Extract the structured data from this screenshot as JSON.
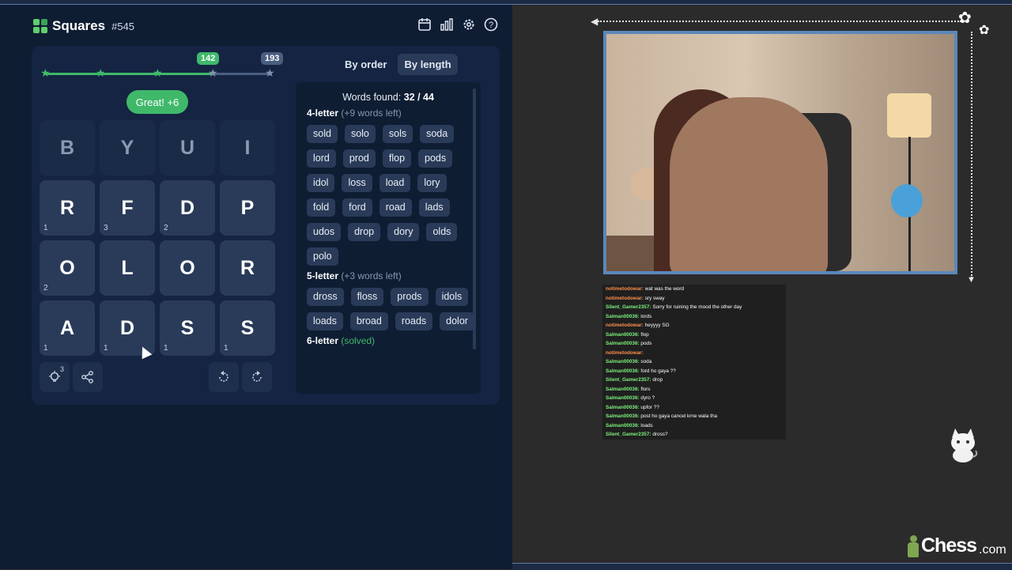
{
  "game": {
    "title": "Squares",
    "number": "#545",
    "icons": [
      "calendar-icon",
      "stats-icon",
      "gear-icon",
      "help-icon"
    ],
    "progress": {
      "current_score_fraction": 0.736,
      "markers": [
        {
          "label": "142"
        },
        {
          "label": "193"
        }
      ]
    },
    "feedback": "Great! +6",
    "tiles": [
      {
        "letter": "B",
        "count": "",
        "dim": true
      },
      {
        "letter": "Y",
        "count": "",
        "dim": true
      },
      {
        "letter": "U",
        "count": "",
        "dim": true
      },
      {
        "letter": "I",
        "count": "",
        "dim": true
      },
      {
        "letter": "R",
        "count": "1"
      },
      {
        "letter": "F",
        "count": "3"
      },
      {
        "letter": "D",
        "count": "2"
      },
      {
        "letter": "P",
        "count": ""
      },
      {
        "letter": "O",
        "count": "2"
      },
      {
        "letter": "L",
        "count": ""
      },
      {
        "letter": "O",
        "count": ""
      },
      {
        "letter": "R",
        "count": ""
      },
      {
        "letter": "A",
        "count": "1"
      },
      {
        "letter": "D",
        "count": "1"
      },
      {
        "letter": "S",
        "count": "1"
      },
      {
        "letter": "S",
        "count": "1"
      }
    ],
    "hint_count": "3",
    "sort": {
      "by_order": "By order",
      "by_length": "By length"
    },
    "words_found_label": "Words found:",
    "words_found_value": "32 / 44",
    "sections": [
      {
        "title": "4-letter",
        "note": "(+9 words left)",
        "words": [
          "sold",
          "solo",
          "sols",
          "soda",
          "lord",
          "prod",
          "flop",
          "pods",
          "idol",
          "loss",
          "load",
          "lory",
          "fold",
          "ford",
          "road",
          "lads",
          "udos",
          "drop",
          "dory",
          "olds",
          "polo"
        ]
      },
      {
        "title": "5-letter",
        "note": "(+3 words left)",
        "words": [
          "dross",
          "floss",
          "prods",
          "idols",
          "loads",
          "broad",
          "roads",
          "dolor"
        ]
      },
      {
        "title": "6-letter",
        "note": "(solved)",
        "words": []
      }
    ]
  },
  "chat": [
    {
      "user": "notimetodowar:",
      "msg": "wat was the word",
      "cls": "u1"
    },
    {
      "user": "notimetodowar:",
      "msg": "sry sway",
      "cls": "u1"
    },
    {
      "user": "Silent_Gamer2357:",
      "msg": "Sorry for ruining the mood the other day",
      "cls": "u2"
    },
    {
      "user": "Salman00036:",
      "msg": "lords",
      "cls": "u2"
    },
    {
      "user": "notimetodowar:",
      "msg": "heyyyy SG",
      "cls": "u1"
    },
    {
      "user": "Salman00036:",
      "msg": "flop",
      "cls": "u2"
    },
    {
      "user": "Salman00036:",
      "msg": "pods",
      "cls": "u2"
    },
    {
      "user": "notimetodowar:",
      "msg": "",
      "cls": "u1"
    },
    {
      "user": "Salman00036:",
      "msg": "soda",
      "cls": "u2"
    },
    {
      "user": "Salman00036:",
      "msg": "ford ho gaya ??",
      "cls": "u2"
    },
    {
      "user": "Silent_Gamer2357:",
      "msg": "drop",
      "cls": "u2"
    },
    {
      "user": "Salman00036:",
      "msg": "flors",
      "cls": "u2"
    },
    {
      "user": "Salman00036:",
      "msg": "dyro ?",
      "cls": "u2"
    },
    {
      "user": "Salman00036:",
      "msg": "upfor ??",
      "cls": "u2"
    },
    {
      "user": "Salman00036:",
      "msg": "post ho gaya cancel krne wala tha",
      "cls": "u2"
    },
    {
      "user": "Salman00036:",
      "msg": "loads",
      "cls": "u2"
    },
    {
      "user": "Silent_Gamer2357:",
      "msg": "dross?",
      "cls": "u2"
    }
  ],
  "brand": {
    "name": "Chess",
    "suffix": ".com"
  },
  "colors": {
    "accent_green": "#3fb86a",
    "panel": "#0f1d33",
    "tile": "#2a3b59",
    "webcam_border": "#5b88ba"
  }
}
